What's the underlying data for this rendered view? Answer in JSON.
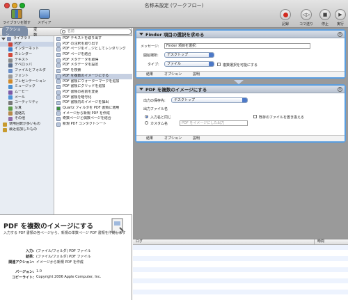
{
  "window": {
    "title": "名称未設定 (ワークフロー)"
  },
  "toolbar": {
    "left": [
      {
        "label": "ライブラリを隠す",
        "icon": "library-icon"
      },
      {
        "label": "メディア",
        "icon": "media-icon"
      }
    ],
    "right": [
      {
        "label": "記録",
        "icon": "record-icon"
      },
      {
        "label": "コマ送り",
        "icon": "step-icon"
      },
      {
        "label": "停止",
        "icon": "stop-icon"
      },
      {
        "label": "実行",
        "icon": "run-icon"
      }
    ]
  },
  "library": {
    "tabs": [
      "アクション",
      "変数"
    ],
    "search_placeholder": "名前",
    "categories": [
      {
        "label": "ライブラリ",
        "color": "#7a8fb6"
      },
      {
        "label": "PDF",
        "color": "#c9453b"
      },
      {
        "label": "インターネット",
        "color": "#3f7fc9"
      },
      {
        "label": "カレンダー",
        "color": "#d24a3d"
      },
      {
        "label": "テキスト",
        "color": "#8a8a8a"
      },
      {
        "label": "デベロッパ",
        "color": "#5b6f8f"
      },
      {
        "label": "ファイルとフォルダ",
        "color": "#6b8fc8"
      },
      {
        "label": "フォント",
        "color": "#9a9a9a"
      },
      {
        "label": "プレゼンテーション",
        "color": "#d08a2a"
      },
      {
        "label": "ミュージック",
        "color": "#4c8fd0"
      },
      {
        "label": "ムービー",
        "color": "#7c5aa8"
      },
      {
        "label": "メール",
        "color": "#4f93d6"
      },
      {
        "label": "ユーティリティ",
        "color": "#7a7a7a"
      },
      {
        "label": "写真",
        "color": "#5e9a4a"
      },
      {
        "label": "連絡先",
        "color": "#b58a4a"
      },
      {
        "label": "その他",
        "color": "#8f6fa8"
      },
      {
        "label": "使用回数が多いもの",
        "color": "#c79a2c"
      },
      {
        "label": "最近追加したもの",
        "color": "#c79a2c"
      }
    ],
    "actions": [
      "PDF テキストを取り出す",
      "PDF の注釈を取り出す",
      "PDF ページをイ...ジとしてレンダリング",
      "PDF ページを結合",
      "PDF メタデータを取得",
      "PDF メタデータを設定",
      "PDF を検索",
      "PDF を複数のイメージにする",
      "PDF 書類にウォーターマークを追加",
      "PDF 書類にグリッドを追加",
      "PDF 書類の名前を変更",
      "PDF 書類を暗号化",
      "PDF 書類内のイメージを抽出",
      "Quartz フィルタを PDF 書類に適用",
      "イメージから新規 PDF を作成",
      "奇数ページと偶数ページを結合",
      "新規 PDF コンタクトシート"
    ]
  },
  "description": {
    "title": "PDF を複数のイメージにする",
    "summary": "入力する PDF 書類の各ページから、新規の単数ページ PDF 書類を作成します",
    "fields": [
      {
        "key": "入力:",
        "value": "(ファイル/フォルダ) PDF ファイル"
      },
      {
        "key": "結果:",
        "value": "(ファイル/フォルダ) PDF ファイル"
      },
      {
        "key": "関連アクション:",
        "value": "イメージから新規 PDF を作成"
      },
      {
        "key": "バージョン:",
        "value": "1.0"
      },
      {
        "key": "コピーライト:",
        "value": "Copyright 2006 Apple Computer, Inc."
      }
    ]
  },
  "workflow": {
    "card1": {
      "title": "Finder 項目の選択を求める",
      "message_label": "メッセージ:",
      "message_value": "Finder 項目を選択:",
      "start_label": "開始場所:",
      "start_value": "デスクトップ",
      "type_label": "タイプ:",
      "type_value": "ファイル",
      "multi_label": "複数選択を可能にする",
      "footer": [
        "結果",
        "オプション",
        "説明"
      ]
    },
    "card2": {
      "title": "PDF を複数のイメージにする",
      "dest_label": "出力の保存先:",
      "dest_value": "デスクトップ",
      "filename_label": "出力ファイル名",
      "radio1": "入力名と同じ",
      "radio2": "カスタム名",
      "custom_placeholder": "PDF をイメージにした出力",
      "replace_label": "既存のファイルを置き換える",
      "footer": [
        "結果",
        "オプション",
        "説明"
      ]
    }
  },
  "log": {
    "columns": [
      "ログ",
      "時間"
    ]
  }
}
